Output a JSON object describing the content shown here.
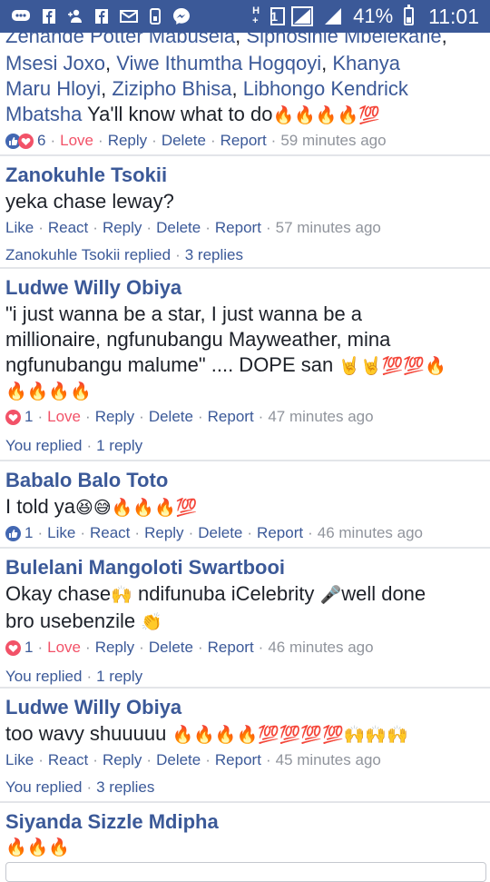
{
  "status_bar": {
    "battery_percent": "41%",
    "time": "11:01",
    "network_badge": "1",
    "icons": [
      "chat-icon",
      "facebook-icon",
      "add-friend-icon",
      "facebook-icon",
      "mail-icon",
      "data-usage-icon",
      "messenger-icon",
      "h-plus-icon",
      "sim-icon",
      "signal-icon",
      "signal-icon",
      "battery-icon"
    ]
  },
  "comments": [
    {
      "author": "",
      "mentions_line1": "Zenande Potter Mabusela",
      "mentions_line1_sep": ", ",
      "mentions_line1b": "Siphosihle Mbelekane",
      "mentions_line1_end": ",",
      "mentions_line2a": "Msesi Joxo",
      "mentions_line2_sep": ", ",
      "mentions_line2b": "Viwe Ithumtha Hogqoyi",
      "mentions_line2_sep2": ", ",
      "mentions_line2c": "Khanya",
      "mentions_line3a": "Maru Hloyi",
      "mentions_line3_sep": ", ",
      "mentions_line3b": "Zizipho Bhisa",
      "mentions_line3_sep2": ", ",
      "mentions_line3c": "Libhongo Kendrick",
      "mentions_line4a": "Mbatsha",
      "text": " Ya'll know what to do",
      "emoji": "🔥🔥🔥🔥💯",
      "reaction_count": "6",
      "reaction_label": "Love",
      "reply_label": "Reply",
      "delete_label": "Delete",
      "report_label": "Report",
      "time": "59 minutes ago"
    },
    {
      "author": "Zanokuhle Tsokii",
      "text": "yeka chase leway?",
      "like_label": "Like",
      "react_label": "React",
      "reply_label": "Reply",
      "delete_label": "Delete",
      "report_label": "Report",
      "time": "57 minutes ago",
      "replies_who": "Zanokuhle Tsokii replied",
      "replies_count": "3 replies"
    },
    {
      "author": "Ludwe Willy Obiya",
      "text_line1": "\"i just wanna be a star, I just wanna be a",
      "text_line2": "millionaire, ngfunubangu Mayweather, mina",
      "text_line3": "ngfunubangu malume\" .... DOPE san",
      "emoji_line3": "🤘🤘💯💯🔥",
      "emoji_line4": "🔥🔥🔥🔥",
      "reaction_count": "1",
      "reaction_label": "Love",
      "reply_label": "Reply",
      "delete_label": "Delete",
      "report_label": "Report",
      "time": "47 minutes ago",
      "replies_who": "You replied",
      "replies_count": "1 reply"
    },
    {
      "author": "Babalo Balo Toto",
      "text": "I told ya",
      "emoji": "😆😅🔥🔥🔥💯",
      "reaction_count": "1",
      "like_label": "Like",
      "react_label": "React",
      "reply_label": "Reply",
      "delete_label": "Delete",
      "report_label": "Report",
      "time": "46 minutes ago"
    },
    {
      "author": "Bulelani Mangoloti Swartbooi",
      "text_line1a": "Okay chase",
      "emoji_a": "🙌",
      "text_line1b": " ndifunuba iCelebrity ",
      "emoji_b": "🎤",
      "text_line1c": "well done",
      "text_line2": "bro usebenzile ",
      "emoji_c": "👏",
      "reaction_count": "1",
      "reaction_label": "Love",
      "reply_label": "Reply",
      "delete_label": "Delete",
      "report_label": "Report",
      "time": "46 minutes ago",
      "replies_who": "You replied",
      "replies_count": "1 reply"
    },
    {
      "author": "Ludwe Willy Obiya",
      "text": "too wavy shuuuuu ",
      "emoji": "🔥🔥🔥🔥💯💯💯💯🙌🙌🙌",
      "like_label": "Like",
      "react_label": "React",
      "reply_label": "Reply",
      "delete_label": "Delete",
      "report_label": "Report",
      "time": "45 minutes ago",
      "replies_who": "You replied",
      "replies_count": "3 replies"
    },
    {
      "author": "Siyanda Sizzle Mdipha",
      "emoji": "🔥🔥🔥"
    }
  ],
  "colors": {
    "brand": "#3b5998",
    "love": "#f25268",
    "meta": "#90949c",
    "text": "#1d2129",
    "divider": "#e3e5e9"
  }
}
